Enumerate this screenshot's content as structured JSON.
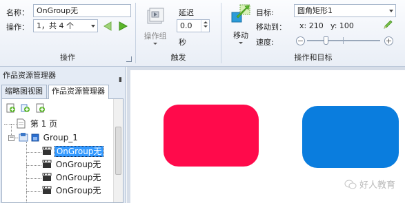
{
  "ribbon": {
    "ops": {
      "name_label": "名称：",
      "name_value": "OnGroup无",
      "op_label": "操作：",
      "op_value": "1，共 4 个",
      "title": "操作"
    },
    "trigger": {
      "op_group_label": "操作组",
      "delay_label": "延迟",
      "delay_value": "0.0",
      "unit_label": "秒",
      "title": "触发"
    },
    "target": {
      "move_label": "移动",
      "target_label": "目标:",
      "target_value": "圆角矩形1",
      "move_to_label": "移动到：",
      "x_text": "x: 210",
      "y_text": "y: 100",
      "speed_label": "速度:",
      "title": "操作和目标",
      "speed_level": 0.25
    }
  },
  "left_panel": {
    "header": "作品资源管理器",
    "pin_glyph": "ㅁ",
    "tabs": [
      "缩略图视图",
      "作品资源管理器"
    ],
    "tree": {
      "page": "第 1 页",
      "group": "Group_1",
      "items": [
        "OnGroup无",
        "OnGroup无",
        "OnGroup无",
        "OnGroup无"
      ]
    }
  },
  "canvas": {
    "shape1_color": "#ff0a4b",
    "shape2_color": "#0a7dde",
    "watermark": "好人教育"
  },
  "colors": {
    "accent_green": "#5ab52a",
    "selection": "#3399ff"
  }
}
